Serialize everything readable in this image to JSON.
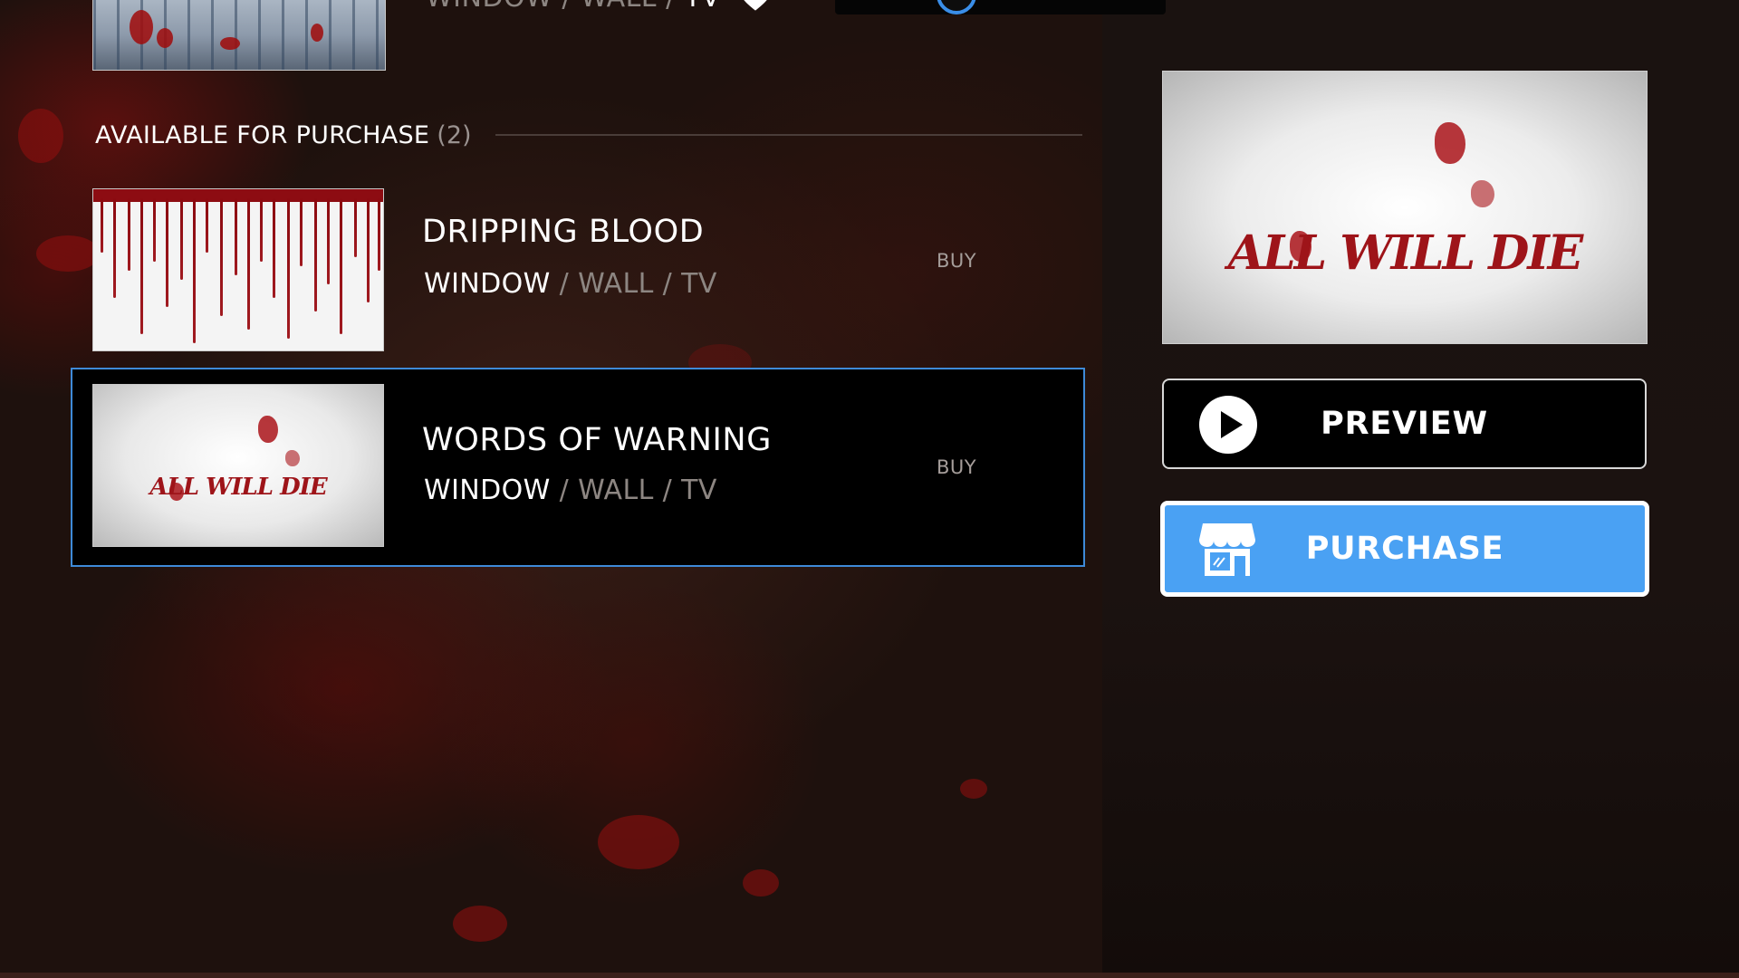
{
  "colors": {
    "accent_blue": "#4aa1f3",
    "selection_border": "#3e8ad8",
    "platform_active": "#ffffff",
    "platform_inactive": "#8d8682",
    "blood_red": "#9e1419"
  },
  "top_item": {
    "platforms": {
      "window": "WINDOW",
      "wall": "WALL",
      "tv": "TV",
      "separator": "/"
    },
    "favorite_icon": "heart-icon",
    "active_platforms": [
      "tv"
    ]
  },
  "section": {
    "title": "AVAILABLE FOR PURCHASE",
    "count": "(2)"
  },
  "items": [
    {
      "title": "DRIPPING BLOOD",
      "platforms": {
        "window": "WINDOW",
        "wall": "WALL",
        "tv": "TV",
        "separator": "/"
      },
      "active_platforms": [
        "window"
      ],
      "action": "BUY",
      "selected": false
    },
    {
      "title": "WORDS OF WARNING",
      "thumb_text": "ALL WILL DIE",
      "platforms": {
        "window": "WINDOW",
        "wall": "WALL",
        "tv": "TV",
        "separator": "/"
      },
      "active_platforms": [
        "window"
      ],
      "action": "BUY",
      "selected": true
    }
  ],
  "detail": {
    "preview_text": "ALL WILL DIE",
    "preview_button": {
      "label": "PREVIEW",
      "icon": "play-icon"
    },
    "purchase_button": {
      "label": "PURCHASE",
      "icon": "store-icon"
    }
  }
}
